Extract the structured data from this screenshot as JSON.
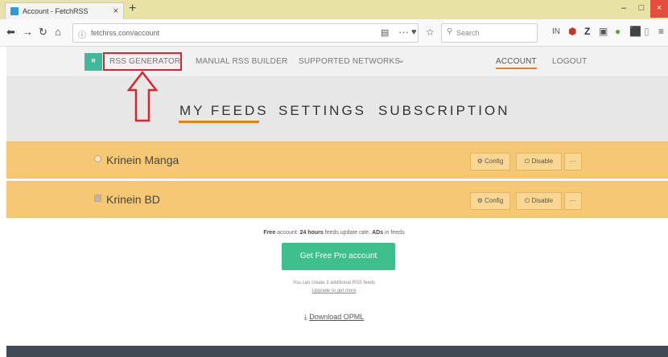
{
  "browser": {
    "tab_title": "Account - FetchRSS",
    "tab_close": "×",
    "new_tab": "+",
    "url": "fetchrss.com/account",
    "search_placeholder": "Search",
    "win_minimize": "–",
    "win_restore": "□",
    "win_close": "×",
    "toolbar_text": "IN",
    "toolbar_z": "Z"
  },
  "site_nav": {
    "logo_text": "R",
    "items": [
      "RSS GENERATOR",
      "MANUAL RSS BUILDER",
      "SUPPORTED NETWORKS"
    ],
    "networks_caret": "⌄",
    "account": "ACCOUNT",
    "logout": "LOGOUT"
  },
  "sub_tabs": [
    "MY FEEDS",
    "SETTINGS",
    "SUBSCRIPTION"
  ],
  "feeds": [
    {
      "name": "Krinein Manga"
    },
    {
      "name": "Krinein BD"
    }
  ],
  "feed_buttons": {
    "config": "Config",
    "disable": "Disable",
    "more": "···"
  },
  "account_info": {
    "free_label": "Free",
    "text1": " account. ",
    "hours": "24 hours",
    "text2": " feeds update rate. ",
    "ads": "ADs",
    "text3": " in feeds",
    "pro_button": "Get Free Pro account",
    "remaining": "You can create 3 additional RSS feeds",
    "upgrade_link": "Upgrade to get more",
    "download": "Download OPML"
  },
  "colors": {
    "accent": "#e67e22",
    "feed_row": "#f7c873",
    "pro_button": "#3dc08d",
    "highlight": "#d6272e"
  }
}
